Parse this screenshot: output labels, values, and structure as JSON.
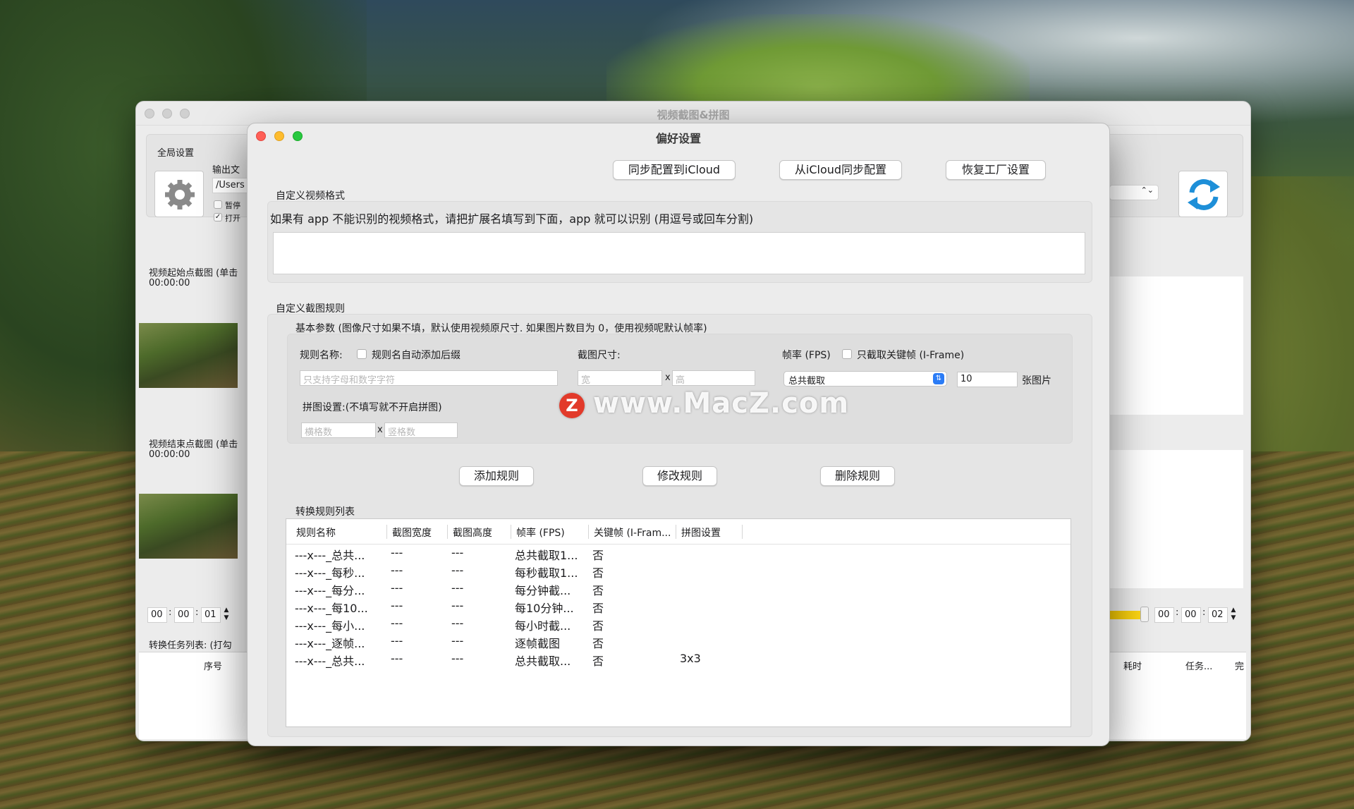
{
  "main_window": {
    "title": "视频截图&拼图",
    "global_settings_label": "全局设置",
    "output_folder_label": "输出文",
    "path_value": "/Users",
    "checkbox_pause": "暂停",
    "checkbox_open": "打开",
    "start_capture_label": "视频起始点截图 (单击",
    "start_time": "00:00:00",
    "end_capture_label": "视频结束点截图 (单击",
    "end_time": "00:00:00",
    "start_stepper": [
      "00",
      "00",
      "01"
    ],
    "end_stepper": [
      "00",
      "00",
      "02"
    ],
    "task_list_label": "转换任务列表: (打勾",
    "task_col_index": "序号",
    "task_col_time": "耗时",
    "task_col_task": "任务...",
    "task_col_done": "完"
  },
  "prefs": {
    "title": "偏好设置",
    "btn_sync_to_icloud": "同步配置到iCloud",
    "btn_sync_from_icloud": "从iCloud同步配置",
    "btn_restore_factory": "恢复工厂设置",
    "custom_video_format_label": "自定义视频格式",
    "custom_video_format_hint": "如果有 app 不能识别的视频格式，请把扩展名填写到下面，app 就可以识别 (用逗号或回车分割)",
    "custom_video_format_value": "",
    "custom_rule_label": "自定义截图规则",
    "basic_params_label": "基本参数 (图像尺寸如果不填，默认使用视频原尺寸. 如果图片数目为 0，使用视频呢默认帧率)",
    "rule_name_label": "规则名称:",
    "auto_suffix_label": "规则名自动添加后缀",
    "rule_name_placeholder": "只支持字母和数字字符",
    "size_label": "截图尺寸:",
    "width_placeholder": "宽",
    "height_placeholder": "高",
    "size_x": "x",
    "fps_label": "帧率 (FPS)",
    "keyframe_only_label": "只截取关键帧 (I-Frame)",
    "fps_mode_value": "总共截取",
    "count_value": "10",
    "count_unit": "张图片",
    "mosaic_label": "拼图设置:(不填写就不开启拼图)",
    "cols_placeholder": "横格数",
    "rows_placeholder": "竖格数",
    "mosaic_x": "x",
    "btn_add_rule": "添加规则",
    "btn_edit_rule": "修改规则",
    "btn_delete_rule": "删除规则",
    "rule_list_label": "转换规则列表",
    "table_headers": [
      "规则名称",
      "截图宽度",
      "截图高度",
      "帧率 (FPS)",
      "关键帧 (I-Fram...",
      "拼图设置"
    ],
    "rows": [
      [
        "---x---_总共...",
        "---",
        "---",
        "总共截取1...",
        "否",
        ""
      ],
      [
        "---x---_每秒...",
        "---",
        "---",
        "每秒截取1...",
        "否",
        ""
      ],
      [
        "---x---_每分...",
        "---",
        "---",
        "每分钟截...",
        "否",
        ""
      ],
      [
        "---x---_每10...",
        "---",
        "---",
        "每10分钟...",
        "否",
        ""
      ],
      [
        "---x---_每小...",
        "---",
        "---",
        "每小时截...",
        "否",
        ""
      ],
      [
        "---x---_逐帧...",
        "---",
        "---",
        "逐帧截图",
        "否",
        ""
      ],
      [
        "---x---_总共...",
        "---",
        "---",
        "总共截取...",
        "否",
        "3x3"
      ]
    ]
  },
  "watermark": {
    "logo_letter": "Z",
    "text": "www.MacZ.com"
  },
  "colors": {
    "close": "#ff5f57",
    "minimize": "#febc2e",
    "zoom": "#28c840",
    "popup_accent": "#2b7cf6",
    "sync_icon": "#1e8fd8"
  }
}
